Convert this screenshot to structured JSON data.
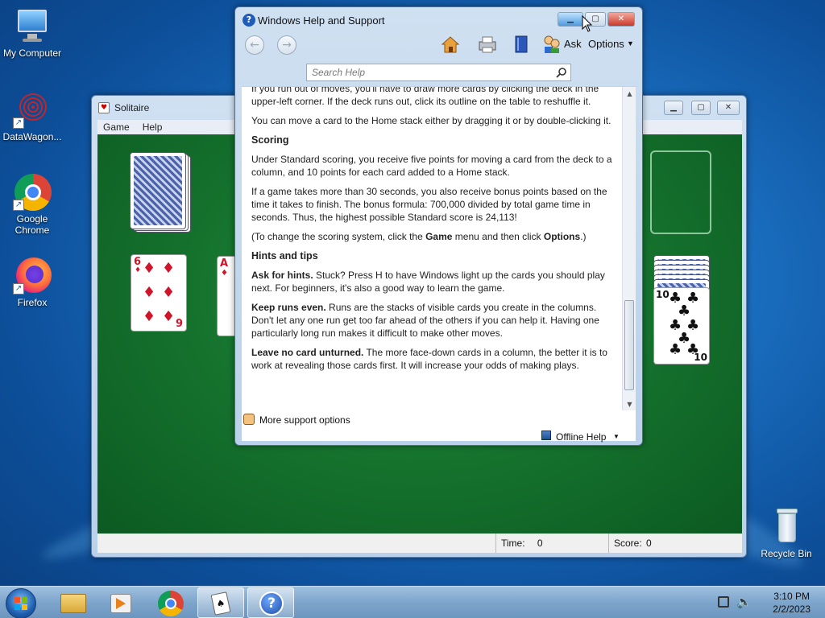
{
  "desktop": {
    "icons": [
      {
        "label": "My Computer"
      },
      {
        "label": "DataWagon..."
      },
      {
        "label": "Google Chrome"
      },
      {
        "label": "Firefox"
      },
      {
        "label": "Recycle Bin"
      }
    ]
  },
  "solitaire": {
    "title": "Solitaire",
    "menu": [
      "Game",
      "Help"
    ],
    "status": {
      "time_label": "Time:",
      "time_value": "0",
      "score_label": "Score:",
      "score_value": "0"
    },
    "cards": {
      "tableau_1": {
        "rank": "6",
        "suit": "♦",
        "bottom_rank": "9"
      },
      "tableau_2": {
        "rank": "A",
        "suit": "♦"
      },
      "right_column": {
        "rank": "10",
        "suit": "♣"
      }
    }
  },
  "help": {
    "title": "Windows Help and Support",
    "toolbar": {
      "ask": "Ask",
      "options": "Options"
    },
    "search_placeholder": "Search Help",
    "p1": "If you run out of moves, you'll have to draw more cards by clicking the deck in the upper-left corner. If the deck runs out, click its outline on the table to reshuffle it.",
    "p2": "You can move a card to the Home stack either by dragging it or by double-clicking it.",
    "h_scoring": "Scoring",
    "p3": "Under Standard scoring, you receive five points for moving a card from the deck to a column, and 10 points for each card added to a Home stack.",
    "p4": "If a game takes more than 30 seconds, you also receive bonus points based on the time it takes to finish. The bonus formula: 700,000 divided by total game time in seconds. Thus, the highest possible Standard score is 24,113!",
    "p5_pre": "(To change the scoring system, click the ",
    "p5_game": "Game",
    "p5_mid": " menu and then click ",
    "p5_options": "Options",
    "p5_post": ".)",
    "h_hints": "Hints and tips",
    "t1_bold": "Ask for hints.",
    "t1_text": " Stuck? Press H to have Windows light up the cards you should play next. For beginners, it's also a good way to learn the game.",
    "t2_bold": "Keep runs even.",
    "t2_text": " Runs are the stacks of visible cards you create in the columns. Don't let any one run get too far ahead of the others if you can help it. Having one particularly long run makes it difficult to make other moves.",
    "t3_bold": "Leave no card unturned.",
    "t3_text": " The more face-down cards in a column, the better it is to work at revealing those cards first. It will increase your odds of making plays.",
    "more_support": "More support options",
    "offline_help": "Offline Help"
  },
  "taskbar": {
    "time": "3:10 PM",
    "date": "2/2/2023"
  },
  "colors": {
    "felt": "#14702c",
    "desktop": "#1a6fc0",
    "card_red": "#d0142a"
  }
}
